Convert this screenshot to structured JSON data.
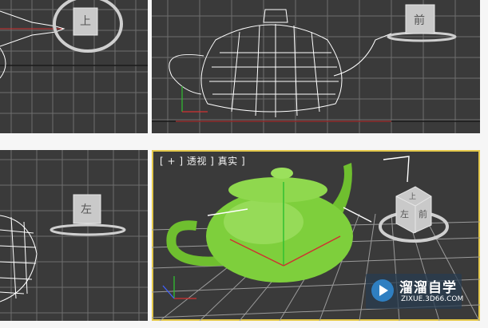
{
  "viewports": {
    "top": {
      "cube_label": "上"
    },
    "front": {
      "cube_label": "前"
    },
    "left": {
      "cube_label": "左"
    },
    "perspective": {
      "label": "[ + ] 透视 ] 真实 ]",
      "cube_label_front": "前",
      "cube_label_left": "左",
      "cube_label_top": "上"
    }
  },
  "watermark": {
    "name": "溜溜自学",
    "url": "ZIXUE.3D66.COM"
  },
  "colors": {
    "viewport_bg": "#3a3a3a",
    "grid": "#7a7a7a",
    "active_border": "#e4c84a",
    "teapot_green": "#7ecf3c",
    "wire": "#ffffff"
  }
}
